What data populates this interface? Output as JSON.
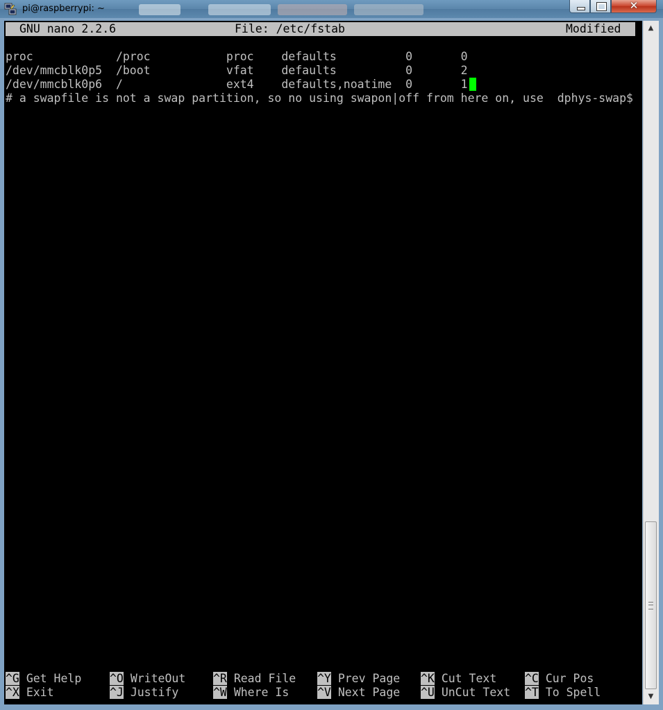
{
  "window": {
    "title": "pi@raspberrypi: ~",
    "close_symbol": "✕"
  },
  "nano": {
    "header": {
      "app": "GNU nano 2.2.6",
      "file": "File: /etc/fstab",
      "state": "Modified"
    },
    "lines": [
      "proc            /proc           proc    defaults          0       0",
      "/dev/mmcblk0p5  /boot           vfat    defaults          0       2",
      "/dev/mmcblk0p6  /               ext4    defaults,noatime  0       1",
      "# a swapfile is not a swap partition, so no using swapon|off from here on, use  dphys-swap$"
    ],
    "shortcuts_row1": [
      {
        "key": "^G",
        "label": "Get Help"
      },
      {
        "key": "^O",
        "label": "WriteOut"
      },
      {
        "key": "^R",
        "label": "Read File"
      },
      {
        "key": "^Y",
        "label": "Prev Page"
      },
      {
        "key": "^K",
        "label": "Cut Text"
      },
      {
        "key": "^C",
        "label": "Cur Pos"
      }
    ],
    "shortcuts_row2": [
      {
        "key": "^X",
        "label": "Exit"
      },
      {
        "key": "^J",
        "label": "Justify"
      },
      {
        "key": "^W",
        "label": "Where Is"
      },
      {
        "key": "^V",
        "label": "Next Page"
      },
      {
        "key": "^U",
        "label": "UnCut Text"
      },
      {
        "key": "^T",
        "label": "To Spell"
      }
    ]
  },
  "colors": {
    "terminal_bg": "#000000",
    "terminal_fg": "#c0c0c0",
    "cursor": "#00ff00",
    "statusbar_bg": "#c0c0c0"
  }
}
